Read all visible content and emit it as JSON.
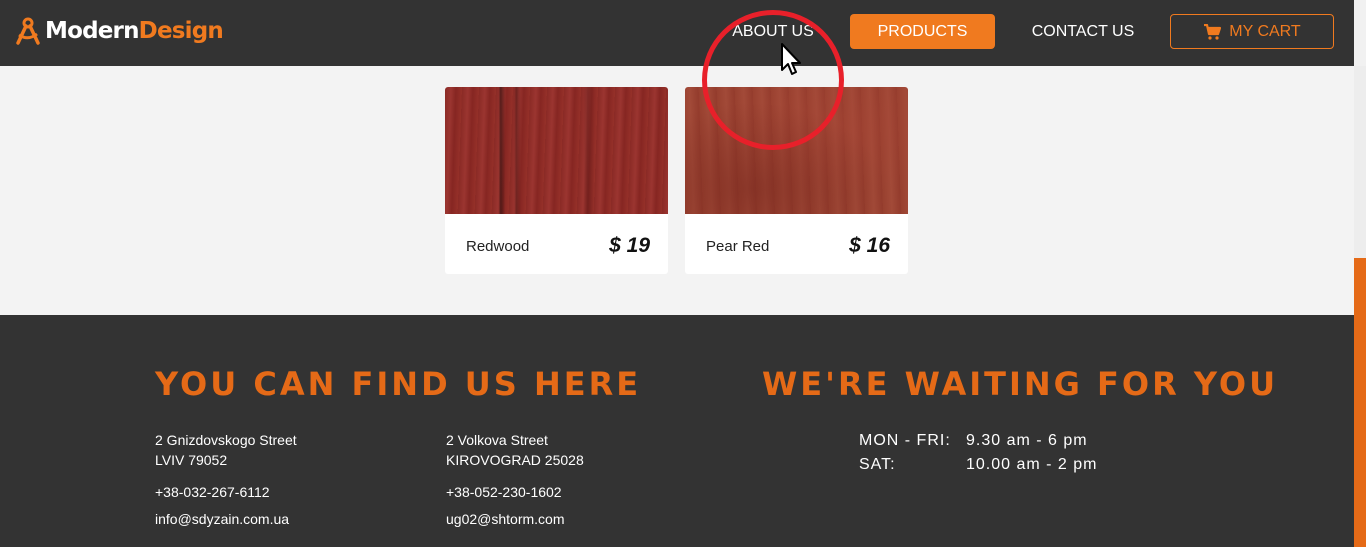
{
  "header": {
    "logo_part1": "Modern",
    "logo_part2": "Design",
    "nav": {
      "about": "ABOUT US",
      "products": "PRODUCTS",
      "contact": "CONTACT US",
      "cart": "MY CART"
    }
  },
  "products": [
    {
      "name": "Redwood",
      "price": "$ 19"
    },
    {
      "name": "Pear Red",
      "price": "$ 16"
    }
  ],
  "footer": {
    "find_heading": "YOU CAN FIND US HERE",
    "waiting_heading": "WE'RE WAITING FOR YOU",
    "location1": {
      "street": "2 Gnizdovskogo Street",
      "city": "LVIV 79052",
      "phone": "+38-032-267-6112",
      "email": "info@sdyzain.com.ua"
    },
    "location2": {
      "street": "2 Volkova Street",
      "city": "KIROVOGRAD 25028",
      "phone": "+38-052-230-1602",
      "email": "ug02@shtorm.com"
    },
    "hours": [
      {
        "day": "MON - FRI:",
        "time": "9.30 am - 6 pm"
      },
      {
        "day": "SAT:",
        "time": "10.00 am - 2 pm"
      }
    ]
  },
  "colors": {
    "accent": "#f07a1f",
    "dark_bg": "#333333",
    "page_bg": "#f3f3f3",
    "annotation": "#e8202a"
  },
  "icons": {
    "logo": "compass-logo-icon",
    "cart": "cart-icon",
    "cursor": "mouse-pointer-icon"
  }
}
